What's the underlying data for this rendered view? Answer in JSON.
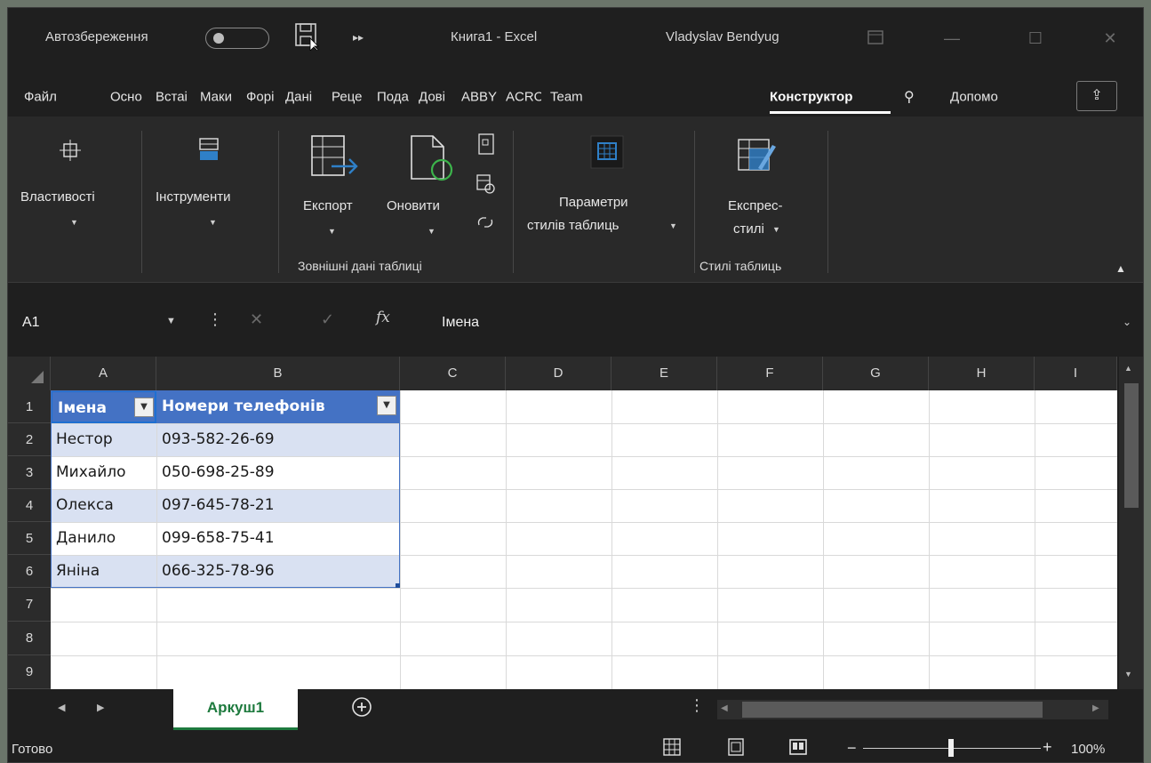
{
  "titlebar": {
    "autosave_label": "Автозбереження",
    "app_title": "Книга1  -  Excel",
    "user_name": "Vladyslav Bendyug"
  },
  "tabs": [
    "Файл",
    "Осно",
    "Встаі",
    "Маки",
    "Форі",
    "Дані",
    "Реце",
    "Пода",
    "Дові",
    "ABBY",
    "ACRO",
    "Team",
    "Конструктор",
    "Допомо"
  ],
  "ribbon": {
    "properties": "Властивості",
    "tools": "Інструменти",
    "export": "Експорт",
    "refresh": "Оновити",
    "style_options_l1": "Параметри",
    "style_options_l2": "стилів таблиць",
    "quick_styles_l1": "Експрес-",
    "quick_styles_l2": "стилі",
    "group_external": "Зовнішні дані таблиці",
    "group_styles": "Стилі таблиць"
  },
  "formula_bar": {
    "name_box": "A1",
    "fx": "fx",
    "value": "Імена"
  },
  "columns": [
    "A",
    "B",
    "C",
    "D",
    "E",
    "F",
    "G",
    "H",
    "I"
  ],
  "rows": [
    "1",
    "2",
    "3",
    "4",
    "5",
    "6",
    "7",
    "8",
    "9"
  ],
  "table": {
    "headers": [
      "Імена",
      "Номери телефонів"
    ],
    "rows": [
      [
        "Нестор",
        "093-582-26-69"
      ],
      [
        "Михайло",
        "050-698-25-89"
      ],
      [
        "Олекса",
        "097-645-78-21"
      ],
      [
        "Данило",
        "099-658-75-41"
      ],
      [
        "Яніна",
        "066-325-78-96"
      ]
    ]
  },
  "sheet_tab": "Аркуш1",
  "status": {
    "ready": "Готово",
    "zoom": "100%"
  }
}
